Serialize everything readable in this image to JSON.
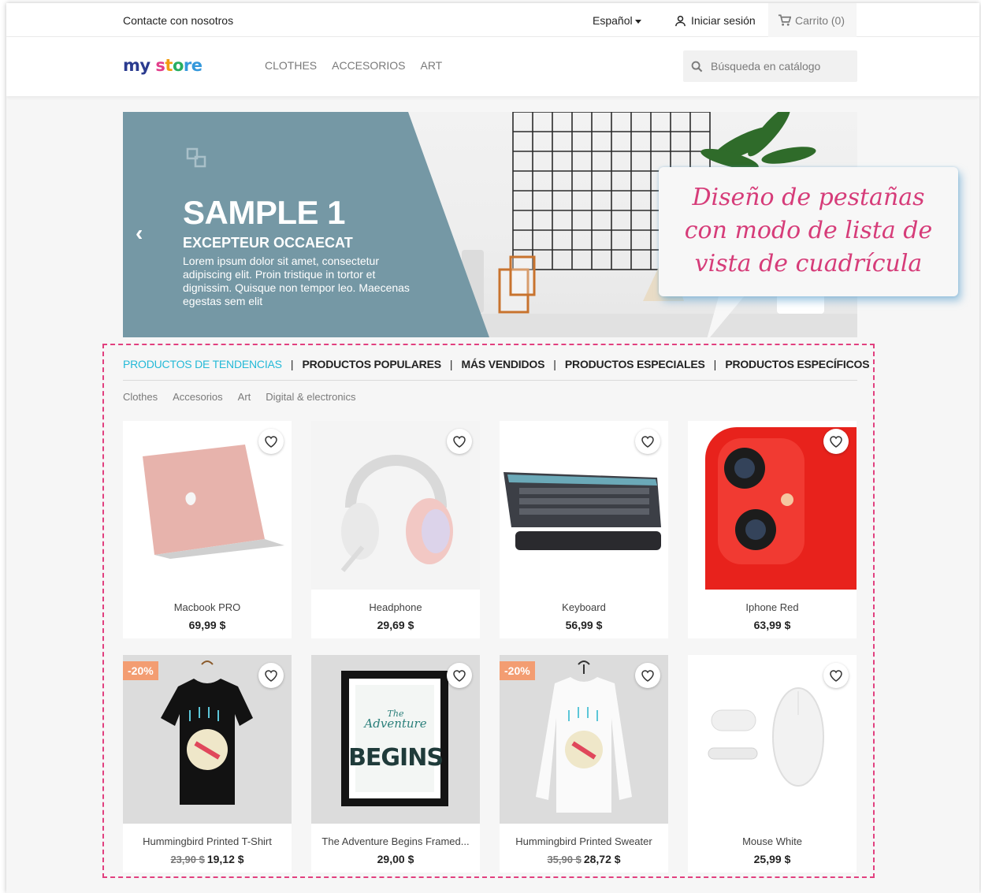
{
  "topbar": {
    "contact": "Contacte con nosotros",
    "language": "Español",
    "login": "Iniciar sesión",
    "cart": "Carrito (0)"
  },
  "header": {
    "logo": {
      "part1": "my",
      "part2": "s",
      "part3": "t",
      "part4": "o",
      "part5": "re"
    },
    "nav": [
      "CLOTHES",
      "ACCESORIOS",
      "ART"
    ],
    "search_placeholder": "Búsqueda en catálogo"
  },
  "slider": {
    "title": "SAMPLE 1",
    "subtitle": "EXCEPTEUR OCCAECAT",
    "text": "Lorem ipsum dolor sit amet, consectetur adipiscing elit. Proin tristique in tortor et dignissim. Quisque non tempor leo. Maecenas egestas sem elit"
  },
  "callout": {
    "line1": "Diseño de pestañas",
    "line2": "con modo de lista de",
    "line3": "vista de cuadrícula"
  },
  "tabs": [
    "PRODUCTOS DE TENDENCIAS",
    "PRODUCTOS POPULARES",
    "MÁS VENDIDOS",
    "PRODUCTOS ESPECIALES",
    "PRODUCTOS ESPECÍFICOS"
  ],
  "subcategories": [
    "Clothes",
    "Accesorios",
    "Art",
    "Digital & electronics"
  ],
  "products": [
    {
      "name": "Macbook PRO",
      "price": "69,99 $",
      "old_price": "",
      "badge": ""
    },
    {
      "name": "Headphone",
      "price": "29,69 $",
      "old_price": "",
      "badge": ""
    },
    {
      "name": "Keyboard",
      "price": "56,99 $",
      "old_price": "",
      "badge": ""
    },
    {
      "name": "Iphone Red",
      "price": "63,99 $",
      "old_price": "",
      "badge": ""
    },
    {
      "name": "Hummingbird Printed T-Shirt",
      "price": "19,12 $",
      "old_price": "23,90 $",
      "badge": "-20%"
    },
    {
      "name": "The Adventure Begins Framed...",
      "price": "29,00 $",
      "old_price": "",
      "badge": "",
      "poster_line1": "The",
      "poster_line2": "Adventure",
      "poster_line3": "BEGINS"
    },
    {
      "name": "Hummingbird Printed Sweater",
      "price": "28,72 $",
      "old_price": "35,90 $",
      "badge": "-20%"
    },
    {
      "name": "Mouse White",
      "price": "25,99 $",
      "old_price": "",
      "badge": ""
    }
  ],
  "colors": {
    "accent": "#24b9d7",
    "callout": "#d63c79",
    "dashed_border": "#e2407f",
    "slider_panel": "#7598a5",
    "badge": "#f39d72"
  }
}
